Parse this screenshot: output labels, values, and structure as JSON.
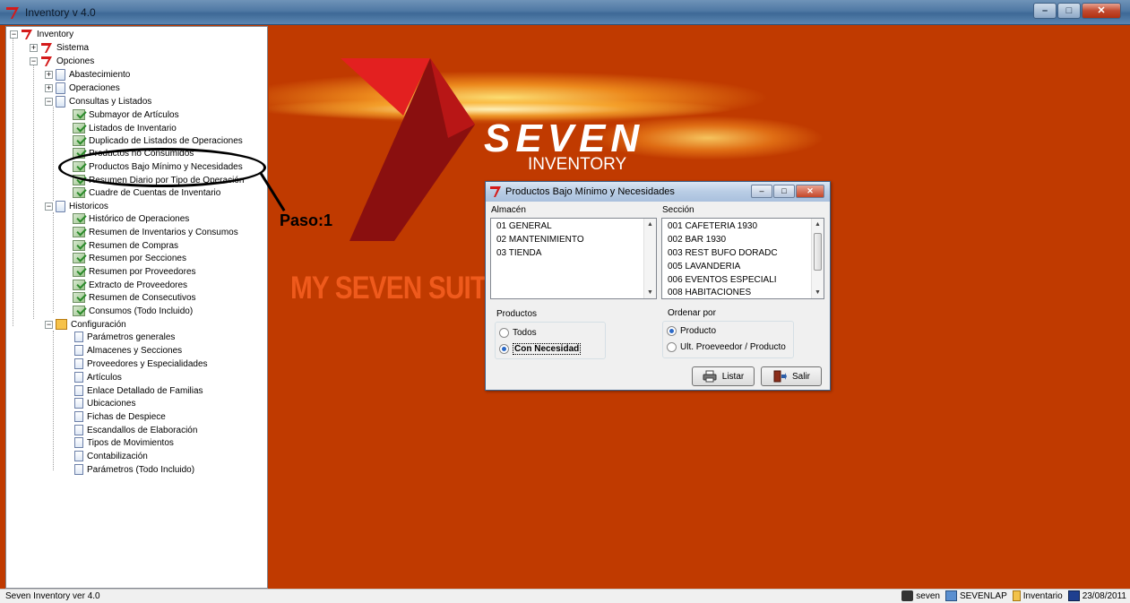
{
  "window": {
    "title": "Inventory v 4.0"
  },
  "tree": {
    "root": "Inventory",
    "sistema": "Sistema",
    "opciones": "Opciones",
    "abastecimiento": "Abastecimiento",
    "operaciones": "Operaciones",
    "consultas": "Consultas y Listados",
    "consultas_items": [
      "Submayor de Artículos",
      "Listados de Inventario",
      "Duplicado de Listados de Operaciones",
      "Productos no Consumidos",
      "Productos Bajo Mínimo y Necesidades",
      "Resumen Diario por Tipo de Operación",
      "Cuadre de Cuentas de Inventario"
    ],
    "historicos": "Historicos",
    "historicos_items": [
      "Histórico de Operaciones",
      "Resumen de Inventarios y Consumos",
      "Resumen de Compras",
      "Resumen por Secciones",
      "Resumen por Proveedores",
      "Extracto de Proveedores",
      "Resumen de Consecutivos",
      "Consumos (Todo Incluido)"
    ],
    "configuracion": "Configuración",
    "configuracion_items": [
      "Parámetros generales",
      "Almacenes y Secciones",
      "Proveedores y Especialidades",
      "Artículos",
      "Enlace Detallado de Familias",
      "Ubicaciones",
      "Fichas de Despiece",
      "Escandallos de Elaboración",
      "Tipos de Movimientos",
      "Contabilización",
      "Parámetros (Todo Incluido)"
    ]
  },
  "annotation": {
    "label": "Paso:1"
  },
  "background": {
    "brand": "SEVEN",
    "product": "INVENTORY",
    "suite": "MY SEVEN SUITE"
  },
  "dialog": {
    "title": "Productos Bajo Mínimo y Necesidades",
    "almacen_label": "Almacén",
    "almacen_items": [
      "01  GENERAL",
      "02  MANTENIMIENTO",
      "03  TIENDA"
    ],
    "seccion_label": "Sección",
    "seccion_items": [
      "001   CAFETERIA 1930",
      "002   BAR 1930",
      "003   REST BUFO DORADC",
      "005   LAVANDERIA",
      "006   EVENTOS ESPECIALI",
      "008   HABITACIONES"
    ],
    "productos_label": "Productos",
    "productos_options": [
      "Todos",
      "Con Necesidad"
    ],
    "productos_selected": "Con Necesidad",
    "ordenar_label": "Ordenar por",
    "ordenar_options": [
      "Producto",
      "Ult. Proeveedor / Producto"
    ],
    "ordenar_selected": "Producto",
    "listar_label": "Listar",
    "salir_label": "Salir"
  },
  "statusbar": {
    "left": "Seven Inventory ver 4.0",
    "user": "seven",
    "machine": "SEVENLAP",
    "module": "Inventario",
    "date": "23/08/2011"
  },
  "colors": {
    "background": "#c03a00",
    "accent_red": "#d01818",
    "suite_orange": "#ef5a1c"
  }
}
